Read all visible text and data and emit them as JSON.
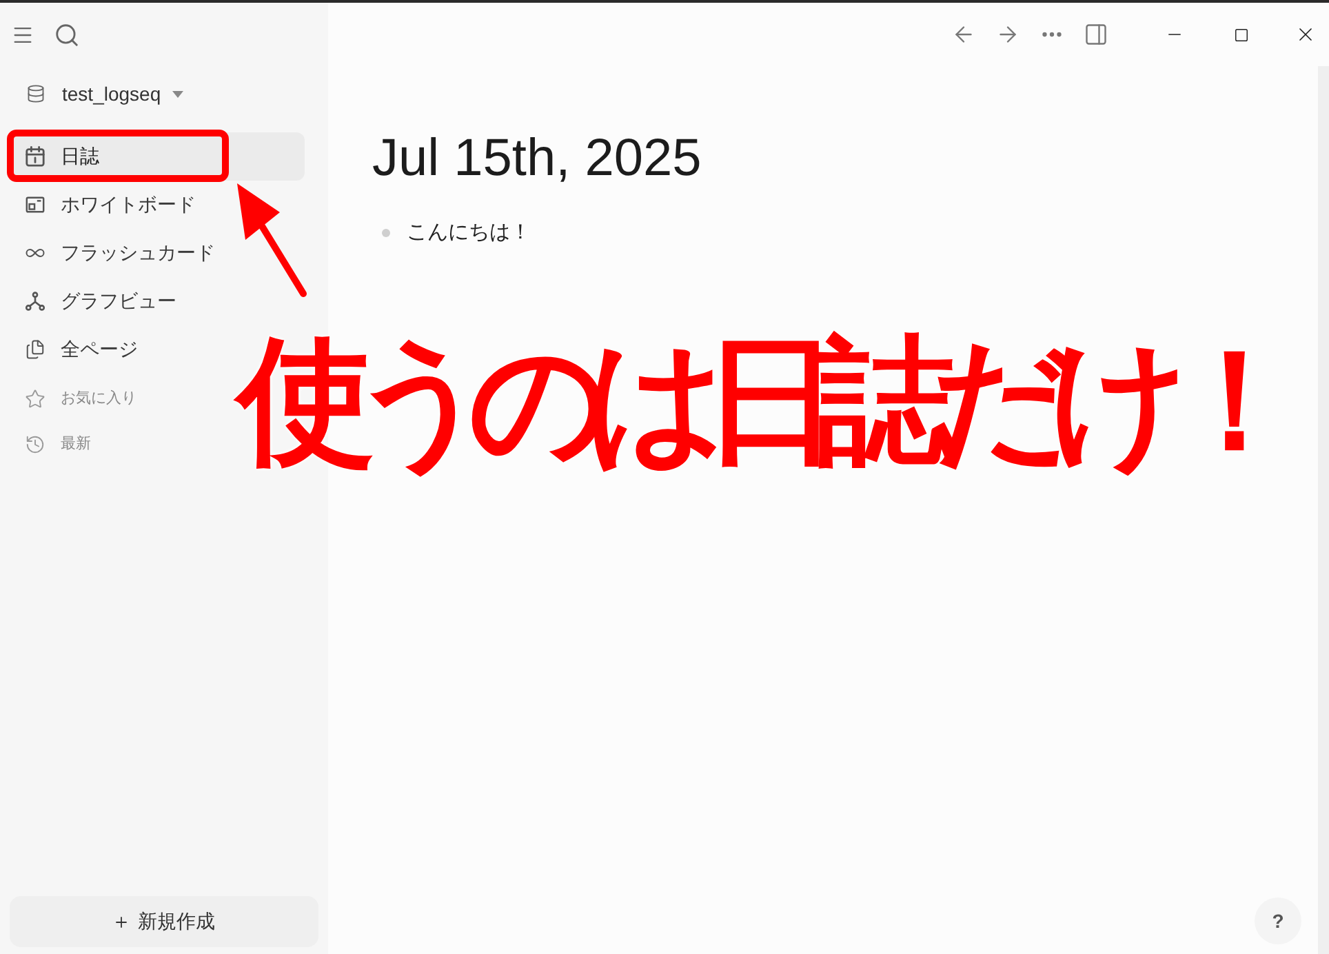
{
  "sidebar": {
    "graph_name": "test_logseq",
    "nav_items": [
      {
        "label": "日誌",
        "selected": true
      },
      {
        "label": "ホワイトボード",
        "selected": false
      },
      {
        "label": "フラッシュカード",
        "selected": false
      },
      {
        "label": "グラフビュー",
        "selected": false
      },
      {
        "label": "全ページ",
        "selected": false
      }
    ],
    "sections": [
      {
        "label": "お気に入り"
      },
      {
        "label": "最新"
      }
    ],
    "new_page_button": "新規作成"
  },
  "page": {
    "title": "Jul 15th, 2025",
    "blocks": [
      "こんにちは！"
    ]
  },
  "help_button": "?",
  "annotation": {
    "callout": "使うのは日誌だけ！"
  }
}
